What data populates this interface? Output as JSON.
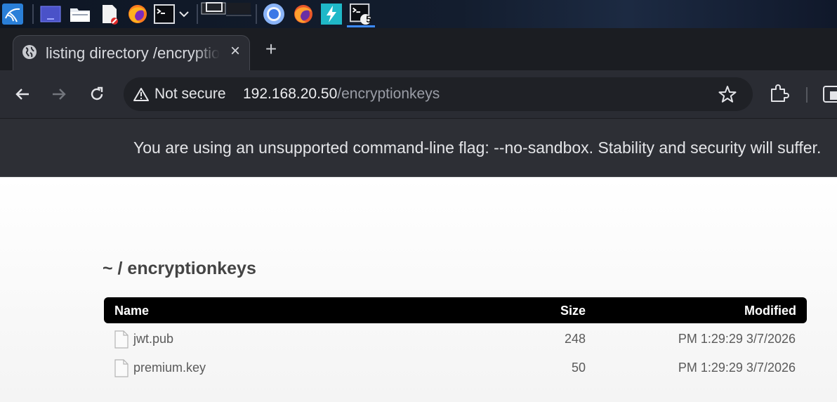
{
  "taskbar": {
    "workspace_badge": "5",
    "icons": [
      "kali-menu-icon",
      "desktop-icon",
      "file-manager-icon",
      "text-editor-icon",
      "firefox-icon",
      "terminal-icon",
      "chevron-down-icon",
      "workspace-switcher-icon",
      "chromium-icon",
      "firefox-window-icon",
      "burpsuite-icon",
      "terminal-window-icon"
    ]
  },
  "browser": {
    "tab": {
      "title": "listing directory /encryptionkeys",
      "close_label": "×"
    },
    "new_tab_label": "+",
    "security_label": "Not secure",
    "url": {
      "host": "192.168.20.50",
      "path": "/encryptionkeys"
    },
    "infobar_message": "You are using an unsupported command-line flag: --no-sandbox. Stability and security will suffer."
  },
  "listing": {
    "breadcrumb": "~ / encryptionkeys",
    "columns": {
      "name": "Name",
      "size": "Size",
      "modified": "Modified"
    },
    "rows": [
      {
        "name": "jwt.pub",
        "size": "248",
        "modified": "PM 1:29:29 3/7/2026"
      },
      {
        "name": "premium.key",
        "size": "50",
        "modified": "PM 1:29:29 3/7/2026"
      }
    ]
  },
  "colors": {
    "accent": "#3d8bff",
    "chrome_dark": "#2a2c33",
    "header_black": "#000000"
  }
}
